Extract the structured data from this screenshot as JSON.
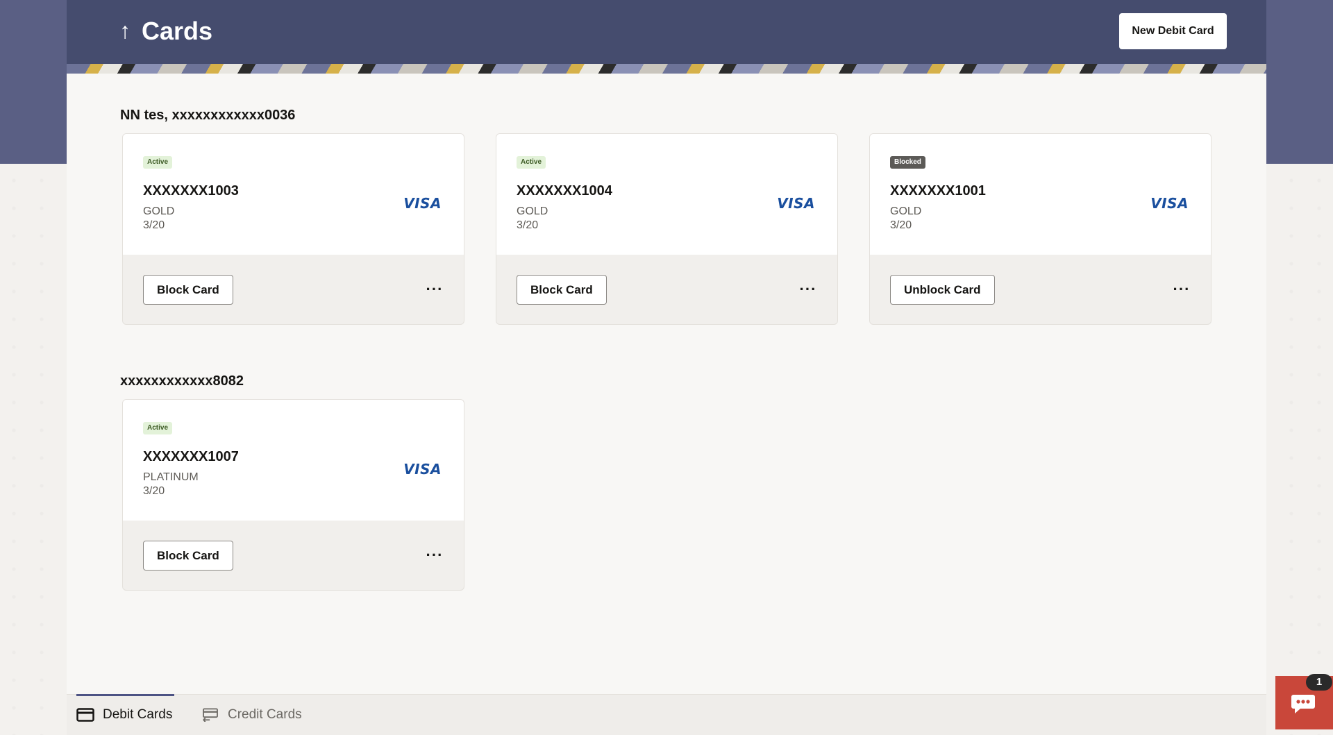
{
  "header": {
    "title": "Cards",
    "back_icon": "arrow-up-icon",
    "new_card_label": "New Debit Card"
  },
  "accounts": [
    {
      "label": "NN tes, xxxxxxxxxxxx0036",
      "cards": [
        {
          "status": "Active",
          "number": "XXXXXXX1003",
          "type": "GOLD",
          "expiry": "3/20",
          "brand": "VISA",
          "action": "Block Card"
        },
        {
          "status": "Active",
          "number": "XXXXXXX1004",
          "type": "GOLD",
          "expiry": "3/20",
          "brand": "VISA",
          "action": "Block Card"
        },
        {
          "status": "Blocked",
          "number": "XXXXXXX1001",
          "type": "GOLD",
          "expiry": "3/20",
          "brand": "VISA",
          "action": "Unblock Card"
        }
      ]
    },
    {
      "label": "xxxxxxxxxxxx8082",
      "cards": [
        {
          "status": "Active",
          "number": "XXXXXXX1007",
          "type": "PLATINUM",
          "expiry": "3/20",
          "brand": "VISA",
          "action": "Block Card"
        }
      ]
    }
  ],
  "more_label": "···",
  "tabs": [
    {
      "label": "Debit Cards",
      "icon": "debit-card-icon",
      "selected": true
    },
    {
      "label": "Credit Cards",
      "icon": "credit-card-icon",
      "selected": false
    }
  ],
  "chat": {
    "count": "1",
    "icon": "chat-bubble-icon"
  },
  "colors": {
    "header": "#454c6e",
    "active_badge": "#e3f2d9",
    "blocked_badge": "#5c5a57",
    "visa": "#1a4f9e",
    "chat": "#c9473a",
    "tab_indicator": "#4d5384"
  }
}
